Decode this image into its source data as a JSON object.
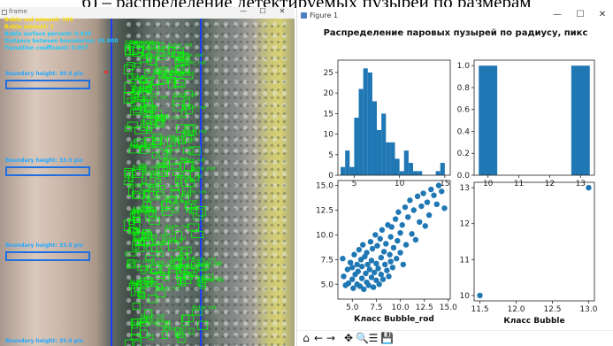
{
  "caption": "б) – распределение детектируемых пузырей по размерам",
  "left_window": {
    "title": "frame",
    "controls": [
      "—",
      "☐",
      "✕"
    ],
    "overlay": {
      "lines": [
        {
          "text": "Buble rod amount:  165",
          "color": "#ffe100"
        },
        {
          "text": "Buble amount:  1",
          "color": "#ffe100"
        },
        {
          "text": "Buble surface percent:  0.434",
          "color": "#1ec8ff"
        },
        {
          "text": "Distance between boundaries:  35.000",
          "color": "#1ec8ff"
        },
        {
          "text": "Transition coefficient:  0.057",
          "color": "#1ec8ff"
        }
      ],
      "boundaries": [
        "Boundary height:  30.0  pix",
        "Boundary height:  33.0  pix",
        "Boundary height:  33.0  pix",
        "Boundary height:  35.0  pix"
      ],
      "detection_label": "Buble_rod"
    }
  },
  "right_window": {
    "title": "Figure 1",
    "controls": [
      "—",
      "☐",
      "✕"
    ],
    "figure_title": "Распределение паровых пузырей по радиусу, пикс",
    "toolbar": [
      {
        "name": "home-icon",
        "glyph": "⌂"
      },
      {
        "name": "back-arrow-icon",
        "glyph": "←"
      },
      {
        "name": "forward-arrow-icon",
        "glyph": "→"
      },
      {
        "name": "pan-icon",
        "glyph": "✥"
      },
      {
        "name": "zoom-icon",
        "glyph": "🔍"
      },
      {
        "name": "configure-icon",
        "glyph": "☰"
      },
      {
        "name": "save-icon",
        "glyph": "💾"
      }
    ]
  },
  "colors": {
    "bar": "#1f77b4",
    "detection": "#00ff00",
    "boundary": "#1e6fe0"
  },
  "chart_data": [
    {
      "type": "bar",
      "title": "",
      "x": [
        3.75,
        4.25,
        4.75,
        5.25,
        5.75,
        6.25,
        6.75,
        7.25,
        7.75,
        8.25,
        8.75,
        9.25,
        9.75,
        10.25,
        10.75,
        11.25,
        11.75,
        12.25,
        12.75,
        13.25,
        13.75,
        14.25,
        14.75
      ],
      "values": [
        2,
        6,
        2,
        14,
        21,
        26,
        25,
        18,
        11,
        15,
        8,
        8,
        4,
        1,
        6,
        3,
        1,
        1,
        0,
        0,
        0,
        1,
        3
      ],
      "bin_width": 0.5,
      "xticks": [
        5,
        10,
        15
      ],
      "yticks": [
        0,
        5,
        10,
        15,
        20,
        25
      ],
      "xlim": [
        3.2,
        15.6
      ],
      "ylim": [
        0,
        28
      ],
      "xlabel": "",
      "ylabel": ""
    },
    {
      "type": "bar",
      "title": "",
      "x": [
        10.0,
        13.0
      ],
      "values": [
        1.0,
        1.0
      ],
      "bin_width": 0.6,
      "xticks": [
        10,
        11,
        12,
        13
      ],
      "yticks": [
        0.0,
        0.2,
        0.4,
        0.6,
        0.8,
        1.0
      ],
      "xlim": [
        9.55,
        13.45
      ],
      "ylim": [
        0,
        1.05
      ],
      "xlabel": "",
      "ylabel": ""
    },
    {
      "type": "scatter",
      "title": "",
      "xlabel": "Класс Bubble_rod",
      "ylabel": "",
      "xticks": [
        5.0,
        7.5,
        10.0,
        12.5,
        15.0
      ],
      "xtick_labels": [
        "5.0",
        "7.5",
        "10.0",
        "12.5",
        "15.0"
      ],
      "yticks": [
        5.0,
        7.5,
        10.0,
        12.5,
        15.0
      ],
      "ytick_labels": [
        "5.0",
        "7.5",
        "10.0",
        "12.5",
        "15.0"
      ],
      "xlim": [
        3.5,
        15.2
      ],
      "ylim": [
        3.5,
        15.5
      ],
      "points": [
        [
          4.0,
          7.6
        ],
        [
          4.1,
          5.8
        ],
        [
          4.3,
          4.9
        ],
        [
          4.5,
          6.5
        ],
        [
          4.6,
          5.1
        ],
        [
          4.8,
          7.2
        ],
        [
          5.0,
          5.5
        ],
        [
          5.0,
          6.7
        ],
        [
          5.1,
          4.6
        ],
        [
          5.2,
          8.0
        ],
        [
          5.3,
          6.0
        ],
        [
          5.5,
          7.0
        ],
        [
          5.5,
          5.0
        ],
        [
          5.6,
          6.3
        ],
        [
          5.7,
          8.5
        ],
        [
          5.8,
          4.8
        ],
        [
          5.9,
          7.5
        ],
        [
          6.0,
          5.6
        ],
        [
          6.0,
          6.8
        ],
        [
          6.1,
          9.0
        ],
        [
          6.2,
          4.5
        ],
        [
          6.3,
          7.8
        ],
        [
          6.4,
          6.1
        ],
        [
          6.5,
          5.2
        ],
        [
          6.5,
          8.2
        ],
        [
          6.6,
          7.0
        ],
        [
          6.7,
          4.9
        ],
        [
          6.8,
          6.5
        ],
        [
          6.9,
          9.3
        ],
        [
          7.0,
          5.7
        ],
        [
          7.0,
          7.4
        ],
        [
          7.1,
          8.6
        ],
        [
          7.2,
          4.7
        ],
        [
          7.3,
          6.2
        ],
        [
          7.4,
          10.0
        ],
        [
          7.5,
          5.4
        ],
        [
          7.5,
          7.1
        ],
        [
          7.6,
          8.9
        ],
        [
          7.7,
          6.6
        ],
        [
          7.8,
          5.0
        ],
        [
          7.9,
          9.6
        ],
        [
          8.0,
          7.7
        ],
        [
          8.0,
          6.0
        ],
        [
          8.1,
          10.5
        ],
        [
          8.2,
          5.5
        ],
        [
          8.3,
          8.3
        ],
        [
          8.4,
          7.0
        ],
        [
          8.5,
          9.1
        ],
        [
          8.6,
          6.4
        ],
        [
          8.7,
          11.0
        ],
        [
          8.8,
          5.8
        ],
        [
          8.9,
          8.0
        ],
        [
          9.0,
          9.8
        ],
        [
          9.0,
          7.3
        ],
        [
          9.1,
          10.8
        ],
        [
          9.2,
          6.7
        ],
        [
          9.3,
          8.7
        ],
        [
          9.5,
          11.6
        ],
        [
          9.6,
          7.6
        ],
        [
          9.7,
          9.4
        ],
        [
          9.8,
          12.3
        ],
        [
          10.0,
          8.2
        ],
        [
          10.0,
          10.2
        ],
        [
          10.2,
          11.0
        ],
        [
          10.3,
          7.0
        ],
        [
          10.5,
          12.8
        ],
        [
          10.6,
          9.0
        ],
        [
          10.8,
          11.8
        ],
        [
          11.0,
          13.5
        ],
        [
          11.2,
          10.1
        ],
        [
          11.4,
          12.5
        ],
        [
          11.6,
          9.5
        ],
        [
          11.8,
          13.9
        ],
        [
          12.0,
          11.3
        ],
        [
          12.2,
          12.9
        ],
        [
          12.4,
          14.2
        ],
        [
          12.6,
          10.9
        ],
        [
          12.8,
          13.3
        ],
        [
          13.0,
          12.0
        ],
        [
          13.2,
          14.6
        ],
        [
          13.5,
          14.0
        ],
        [
          13.8,
          13.1
        ],
        [
          14.0,
          15.0
        ],
        [
          14.3,
          14.4
        ],
        [
          14.6,
          12.7
        ]
      ]
    },
    {
      "type": "scatter",
      "title": "",
      "xlabel": "Класс Bubble",
      "ylabel": "",
      "xticks": [
        11.5,
        12.0,
        12.5,
        13.0
      ],
      "xtick_labels": [
        "11.5",
        "12.0",
        "12.5",
        "13.0"
      ],
      "yticks": [
        10,
        11,
        12,
        13
      ],
      "ytick_labels": [
        "10",
        "11",
        "12",
        "13"
      ],
      "xlim": [
        11.42,
        13.08
      ],
      "ylim": [
        9.85,
        13.15
      ],
      "points": [
        [
          11.5,
          10.0
        ],
        [
          13.0,
          13.0
        ]
      ]
    }
  ]
}
